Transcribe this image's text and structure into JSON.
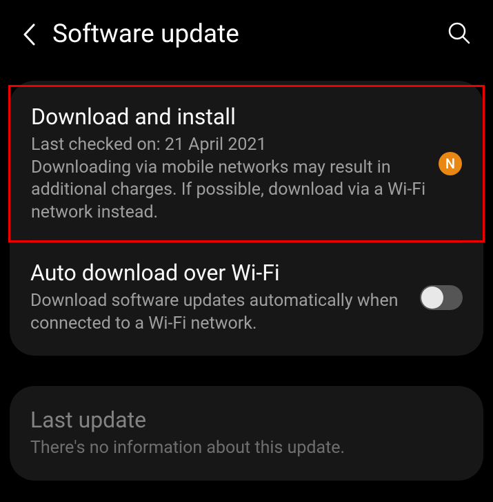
{
  "header": {
    "title": "Software update"
  },
  "card1": {
    "download": {
      "title": "Download and install",
      "desc": "Last checked on: 21 April 2021\nDownloading via mobile networks may result in additional charges. If possible, download via a Wi-Fi network instead.",
      "badge": "N"
    },
    "auto": {
      "title": "Auto download over Wi-Fi",
      "desc": "Download software updates automatically when connected to a Wi-Fi network."
    }
  },
  "card2": {
    "last": {
      "title": "Last update",
      "desc": "There's no information about this update."
    }
  }
}
